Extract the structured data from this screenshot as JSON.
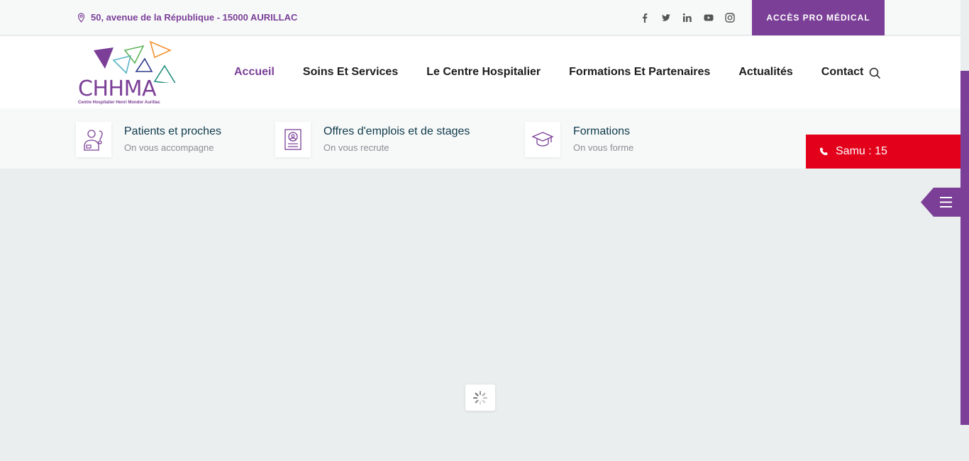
{
  "topbar": {
    "address": "50, avenue de la République - 15000 AURILLAC",
    "socials": [
      "facebook-icon",
      "twitter-icon",
      "linkedin-icon",
      "youtube-icon",
      "instagram-icon"
    ],
    "pro_button": "ACCÈS PRO MÉDICAL"
  },
  "header": {
    "logo_text": "CHHMA",
    "logo_subtitle": "Centre Hospitalier Henri Mondor Aurillac",
    "nav": [
      "Accueil",
      "Soins Et Services",
      "Le Centre Hospitalier",
      "Formations Et Partenaires",
      "Actualités",
      "Contact"
    ]
  },
  "quick_links": [
    {
      "title": "Patients et proches",
      "subtitle": "On vous accompagne",
      "icon": "doctor-icon"
    },
    {
      "title": "Offres d'emplois et de stages",
      "subtitle": "On vous recrute",
      "icon": "resume-icon"
    },
    {
      "title": "Formations",
      "subtitle": "On vous forme",
      "icon": "graduation-cap-icon"
    }
  ],
  "samu": "Samu : 15",
  "colors": {
    "brand": "#7b3f97",
    "samu": "#e2001a",
    "page_bg": "#eaeeef"
  }
}
